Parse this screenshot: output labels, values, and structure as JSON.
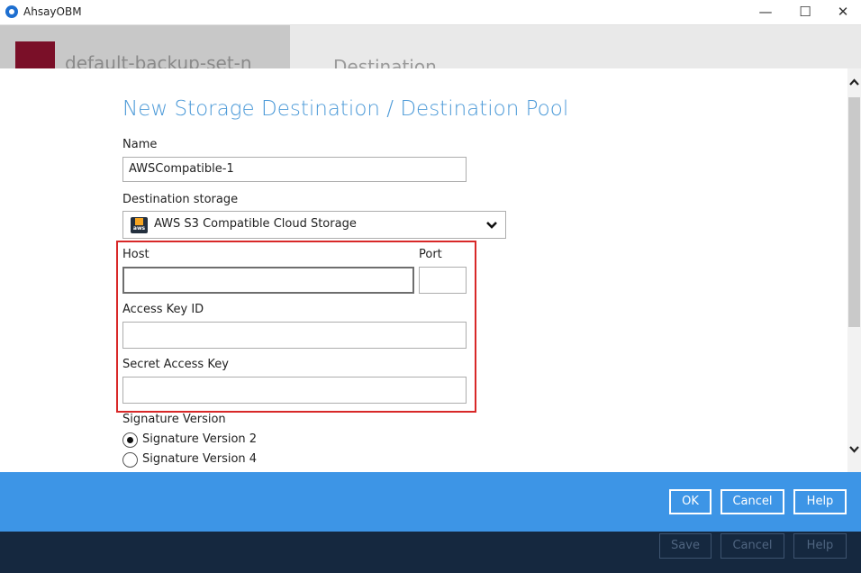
{
  "window": {
    "title": "AhsayOBM",
    "min_glyph": "—",
    "max_glyph": "☐",
    "close_glyph": "✕"
  },
  "background": {
    "backup_set_name": "default-backup-set-n",
    "section_title": "Destination",
    "buttons": {
      "save": "Save",
      "cancel": "Cancel",
      "help": "Help"
    }
  },
  "dialog": {
    "heading": "New Storage Destination / Destination Pool",
    "name": {
      "label": "Name",
      "value": "AWSCompatible-1"
    },
    "destination_storage": {
      "label": "Destination storage",
      "selected": "AWS S3 Compatible Cloud Storage",
      "icon": "aws-icon",
      "icon_text": "aws"
    },
    "host": {
      "label": "Host",
      "value": ""
    },
    "port": {
      "label": "Port",
      "value": ""
    },
    "access_key_id": {
      "label": "Access Key ID",
      "value": ""
    },
    "secret_access_key": {
      "label": "Secret Access Key",
      "value": ""
    },
    "signature_version": {
      "label": "Signature Version",
      "options": [
        {
          "label": "Signature Version 2",
          "selected": true
        },
        {
          "label": "Signature Version 4",
          "selected": false
        }
      ]
    }
  },
  "actions": {
    "ok": "OK",
    "cancel": "Cancel",
    "help": "Help"
  },
  "colors": {
    "heading": "#4c9ad8",
    "action_bar": "#3d95e6",
    "highlight": "#d82828",
    "footer": "#15283f"
  }
}
